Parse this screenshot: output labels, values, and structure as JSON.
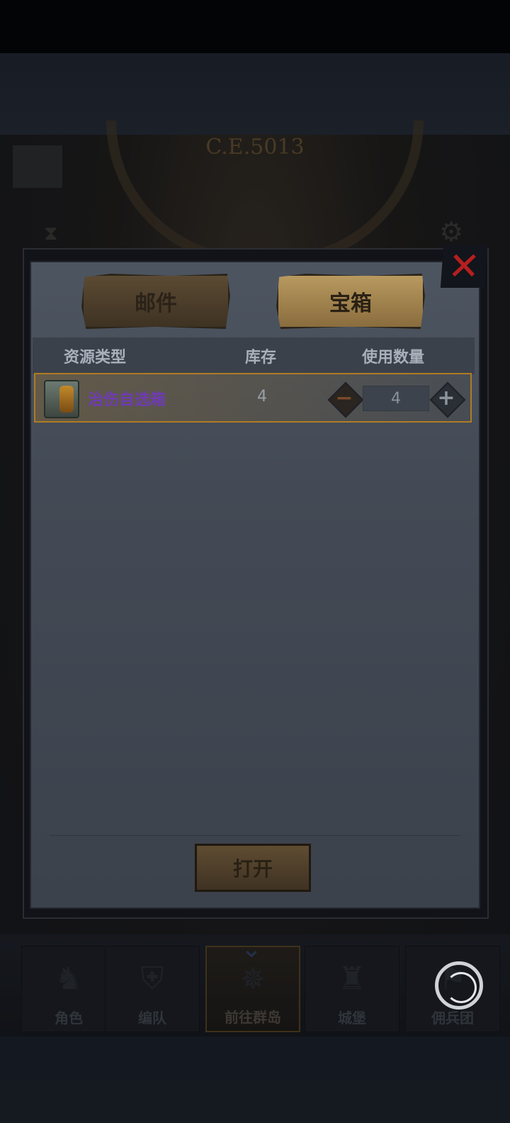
{
  "background": {
    "era_label": "C.E.5013"
  },
  "tabs": {
    "mail": "邮件",
    "chest": "宝箱"
  },
  "table": {
    "headers": [
      "资源类型",
      "库存",
      "使用数量"
    ],
    "rows": [
      {
        "name": "治伤自选箱",
        "stock": "4",
        "quantity": "4"
      }
    ]
  },
  "buttons": {
    "open": "打开",
    "minus": "−",
    "plus": "+",
    "close": "✕"
  },
  "nav": {
    "items": [
      "角色",
      "编队",
      "前往群岛",
      "城堡",
      "佣兵团"
    ]
  },
  "colors": {
    "item_name": "#6f3bb4",
    "close": "#b51f1f",
    "row_border": "#b07b24"
  }
}
